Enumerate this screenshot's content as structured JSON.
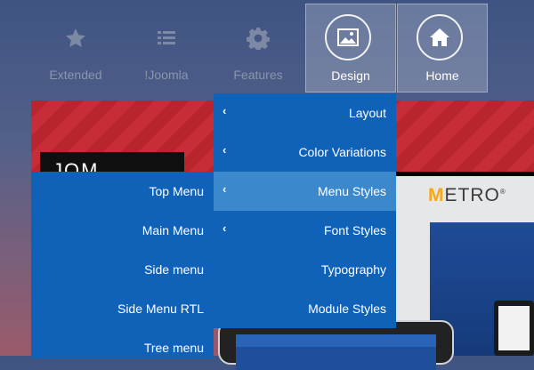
{
  "nav": {
    "items": [
      {
        "label": "Extended",
        "icon": "star-icon"
      },
      {
        "label": "!Joomla",
        "icon": "list-icon"
      },
      {
        "label": "Features",
        "icon": "gear-icon"
      },
      {
        "label": "Design",
        "icon": "image-icon",
        "active": true
      },
      {
        "label": "Home",
        "icon": "home-icon",
        "active": true
      }
    ]
  },
  "banner": {
    "text": "JOM METRO"
  },
  "preview": {
    "logo_letter": "M",
    "logo_rest": "ETRO",
    "registered": "®"
  },
  "design_submenu": {
    "items": [
      {
        "label": "Layout",
        "has_children": true
      },
      {
        "label": "Color Variations",
        "has_children": true
      },
      {
        "label": "Menu Styles",
        "has_children": true,
        "highlighted": true
      },
      {
        "label": "Font Styles",
        "has_children": true
      },
      {
        "label": "Typography",
        "has_children": false
      },
      {
        "label": "Module Styles",
        "has_children": false
      }
    ]
  },
  "menu_styles_submenu": {
    "items": [
      {
        "label": "Top Menu"
      },
      {
        "label": "Main Menu"
      },
      {
        "label": "Side menu"
      },
      {
        "label": "Side Menu RTL"
      },
      {
        "label": "Tree menu"
      }
    ]
  },
  "colors": {
    "menu_bg": "#1062b8",
    "menu_highlight": "#3b88cc",
    "banner_red": "#b9252f",
    "nav_text": "#8a95ad"
  }
}
